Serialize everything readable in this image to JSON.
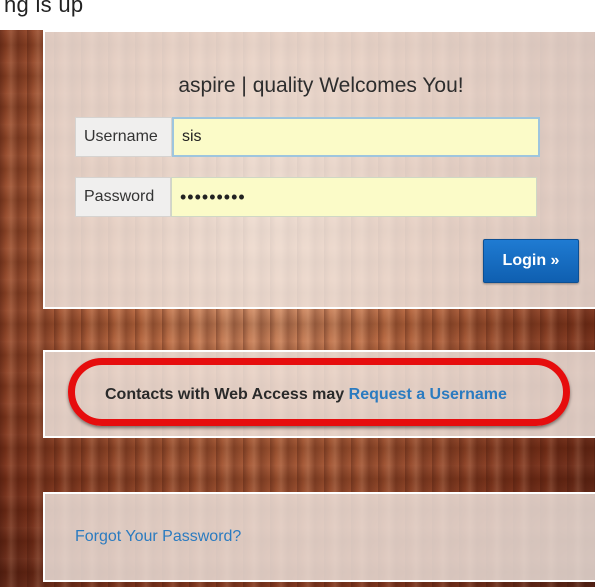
{
  "header": {
    "partial_text": "ng is up"
  },
  "login_panel": {
    "welcome": "aspire | quality Welcomes You!",
    "username": {
      "label": "Username",
      "value": "sis"
    },
    "password": {
      "label": "Password",
      "value": "•••••••••"
    },
    "login_button": "Login »"
  },
  "request_panel": {
    "text": "Contacts with Web Access may",
    "link": "Request a Username"
  },
  "forgot_panel": {
    "link": "Forgot Your Password?"
  },
  "colors": {
    "accent_blue": "#1f7bd2",
    "link_blue": "#2b7bc0",
    "highlight_red": "#e60d0d",
    "input_yellow": "#fbfbc8"
  },
  "icons": [
    "double-chevron-right-icon"
  ]
}
